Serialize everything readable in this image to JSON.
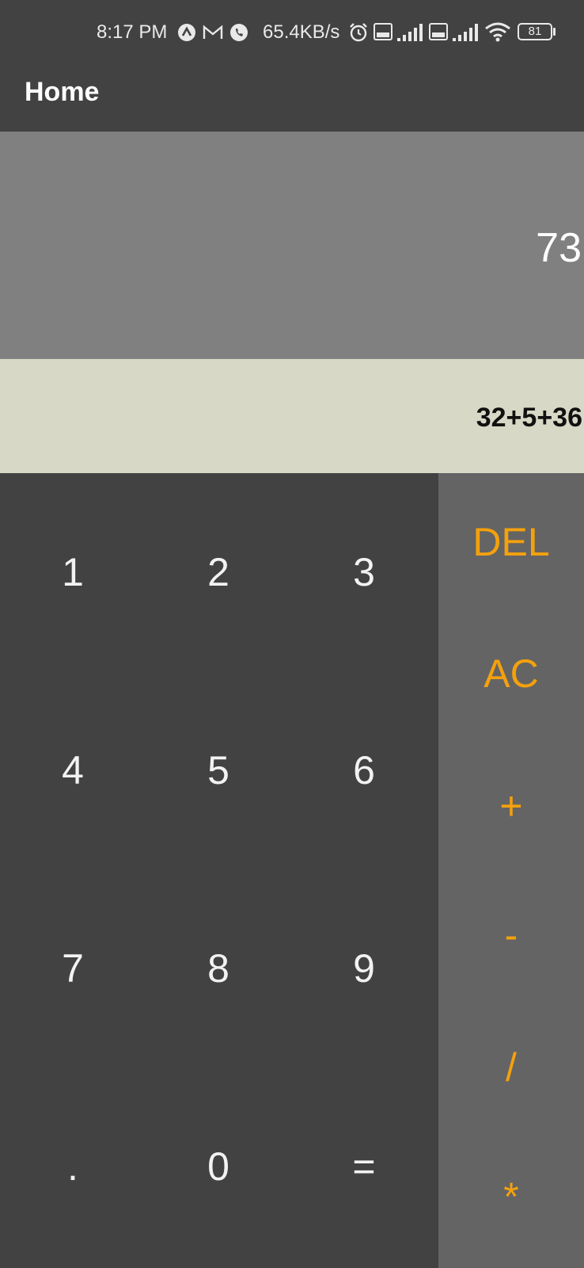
{
  "status_bar": {
    "time": "8:17 PM",
    "network_speed": "65.4KB/s",
    "battery": "81",
    "icons": [
      "nav-icon",
      "gmail-icon",
      "phone-icon",
      "alarm-icon",
      "volte-icon",
      "signal-icon",
      "volte-icon",
      "signal-icon",
      "wifi-icon",
      "battery-icon"
    ]
  },
  "app_bar": {
    "title": "Home"
  },
  "display": {
    "result": "73",
    "expression": "32+5+36"
  },
  "keypad": {
    "digits": [
      "1",
      "2",
      "3",
      "4",
      "5",
      "6",
      "7",
      "8",
      "9",
      ".",
      "0",
      "="
    ]
  },
  "operators": [
    "DEL",
    "AC",
    "+",
    "-",
    "/",
    "*"
  ],
  "colors": {
    "background": "#424242",
    "result_panel": "#808080",
    "expression_panel": "#d8d8c6",
    "operator_panel": "#646464",
    "accent": "#f4a10d"
  }
}
